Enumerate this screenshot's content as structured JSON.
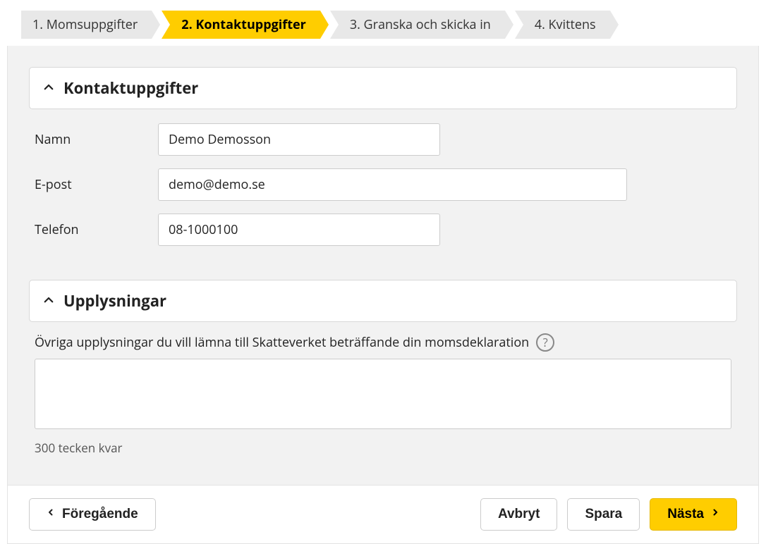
{
  "steps": [
    {
      "label": "1. Momsuppgifter"
    },
    {
      "label": "2. Kontaktuppgifter"
    },
    {
      "label": "3. Granska och skicka in"
    },
    {
      "label": "4. Kvittens"
    }
  ],
  "sections": {
    "contact": {
      "title": "Kontaktuppgifter",
      "fields": {
        "name_label": "Namn",
        "name_value": "Demo Demosson",
        "email_label": "E-post",
        "email_value": "demo@demo.se",
        "phone_label": "Telefon",
        "phone_value": "08-1000100"
      }
    },
    "info": {
      "title": "Upplysningar",
      "label": "Övriga upplysningar du vill lämna till Skatteverket beträffande din momsdeklaration",
      "textarea_value": "",
      "char_remaining": "300 tecken kvar"
    }
  },
  "footer": {
    "prev": "Föregående",
    "cancel": "Avbryt",
    "save": "Spara",
    "next": "Nästa"
  },
  "icons": {
    "help": "?"
  }
}
